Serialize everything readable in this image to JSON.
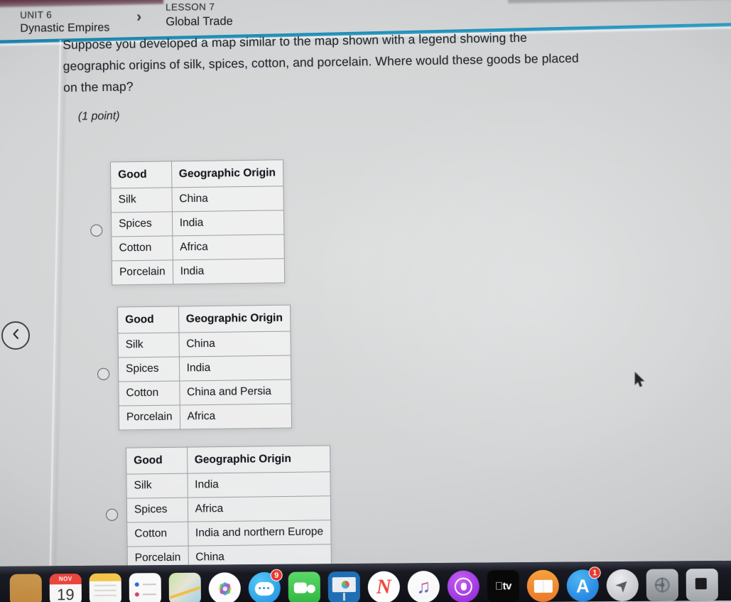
{
  "breadcrumb": {
    "unit_label": "UNIT 6",
    "unit_title": "Dynastic Empires",
    "separator": "›",
    "lesson_label": "LESSON 7",
    "lesson_title": "Global Trade"
  },
  "question": {
    "text": "Suppose you developed a map similar to the map shown with a legend showing the geographic origins of silk, spices, cotton, and porcelain. Where would these goods be placed on the map?",
    "points": "(1 point)"
  },
  "table_headers": {
    "good": "Good",
    "origin": "Geographic Origin"
  },
  "options": [
    {
      "id": "option-1",
      "selected": false,
      "rows": [
        {
          "good": "Silk",
          "origin": "China"
        },
        {
          "good": "Spices",
          "origin": "India"
        },
        {
          "good": "Cotton",
          "origin": "Africa"
        },
        {
          "good": "Porcelain",
          "origin": "India"
        }
      ]
    },
    {
      "id": "option-2",
      "selected": false,
      "rows": [
        {
          "good": "Silk",
          "origin": "China"
        },
        {
          "good": "Spices",
          "origin": "India"
        },
        {
          "good": "Cotton",
          "origin": "China and Persia"
        },
        {
          "good": "Porcelain",
          "origin": "Africa"
        }
      ]
    },
    {
      "id": "option-3",
      "selected": false,
      "rows": [
        {
          "good": "Silk",
          "origin": "India"
        },
        {
          "good": "Spices",
          "origin": "Africa"
        },
        {
          "good": "Cotton",
          "origin": "India and northern Europe"
        },
        {
          "good": "Porcelain",
          "origin": "China"
        }
      ]
    }
  ],
  "nav": {
    "prev_icon": "chevron-left-icon"
  },
  "dock": {
    "items": [
      {
        "name": "finder",
        "class": "ic-finder",
        "badge": null
      },
      {
        "name": "calendar",
        "class": "ic-calendar",
        "badge": null,
        "month": "NOV",
        "day": "19"
      },
      {
        "name": "notes",
        "class": "ic-notes",
        "badge": null
      },
      {
        "name": "contacts",
        "class": "ic-contacts",
        "badge": null
      },
      {
        "name": "maps",
        "class": "ic-maps",
        "badge": null
      },
      {
        "name": "photos",
        "class": "ic-photos",
        "badge": null
      },
      {
        "name": "messages",
        "class": "ic-messages",
        "badge": "9"
      },
      {
        "name": "facetime",
        "class": "ic-facetime",
        "badge": null
      },
      {
        "name": "keynote",
        "class": "ic-keynote",
        "badge": null
      },
      {
        "name": "news",
        "class": "ic-news",
        "badge": null,
        "glyph": "N"
      },
      {
        "name": "music",
        "class": "ic-music",
        "badge": null,
        "glyph": "♫"
      },
      {
        "name": "podcasts",
        "class": "ic-podcasts",
        "badge": null
      },
      {
        "name": "apple-tv",
        "class": "ic-appletv",
        "badge": null,
        "glyph": "tv"
      },
      {
        "name": "books",
        "class": "ic-books",
        "badge": null
      },
      {
        "name": "app-store",
        "class": "ic-appstore",
        "badge": "1",
        "glyph": "A"
      },
      {
        "name": "launchpad",
        "class": "ic-launchpad",
        "badge": null,
        "glyph": "➤"
      },
      {
        "name": "system-preferences",
        "class": "ic-syspref",
        "badge": null
      },
      {
        "name": "unknown-app",
        "class": "ic-partial",
        "badge": null
      }
    ]
  },
  "colors": {
    "accent_rule": "#1f8db6",
    "badge_red": "#e8392d",
    "page_background": "#d2d4d5",
    "text_primary": "#23272b",
    "table_border": "#9ba0a5",
    "dock_background": "#14151c"
  }
}
